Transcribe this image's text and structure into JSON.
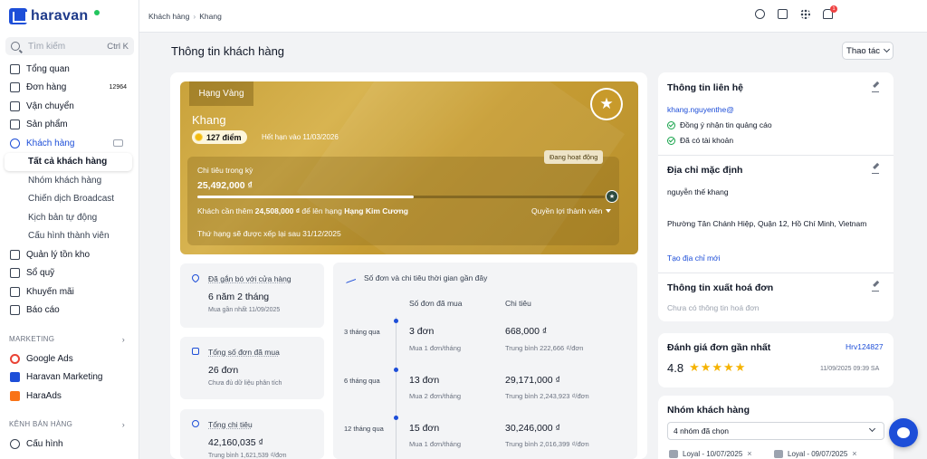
{
  "app": {
    "brand": "haravan"
  },
  "sidebar": {
    "search_placeholder": "Tìm kiếm",
    "search_shortcut": "Ctrl K",
    "items": [
      {
        "label": "Tổng quan",
        "icon": "dashboard-icon"
      },
      {
        "label": "Đơn hàng",
        "icon": "cart-icon",
        "badge": "12964"
      },
      {
        "label": "Vận chuyển",
        "icon": "truck-icon"
      },
      {
        "label": "Sản phẩm",
        "icon": "tag-icon"
      },
      {
        "label": "Khách hàng",
        "icon": "users-icon"
      }
    ],
    "customer_subitems": [
      "Tất cả khách hàng",
      "Nhóm khách hàng",
      "Chiến dịch Broadcast",
      "Kịch bản tự động",
      "Cấu hình thành viên"
    ],
    "items_after": [
      {
        "label": "Quản lý tồn kho",
        "icon": "inventory-icon"
      },
      {
        "label": "Sổ quỹ",
        "icon": "cash-icon"
      },
      {
        "label": "Khuyến mãi",
        "icon": "gift-icon"
      },
      {
        "label": "Báo cáo",
        "icon": "report-icon"
      }
    ],
    "group_marketing": "MARKETING",
    "marketing_items": [
      {
        "label": "Google Ads",
        "color": "#ea4335"
      },
      {
        "label": "Haravan Marketing",
        "color": "#1d4ed8"
      },
      {
        "label": "HaraAds",
        "color": "#f97316"
      }
    ],
    "group_channels": "KÊNH BÁN HÀNG",
    "settings_label": "Cấu hình"
  },
  "topbar": {
    "breadcrumb": [
      "Khách hàng",
      "Khang"
    ],
    "notification_count": "1"
  },
  "main": {
    "title": "Thông tin khách hàng",
    "actions_label": "Thao tác"
  },
  "membership": {
    "rank": "Hạng Vàng",
    "name": "Khang",
    "points": "127 điểm",
    "expiry": "Hết hạn vào 11/03/2026",
    "status": "Đang hoạt động",
    "spend_label": "Chi tiêu trong kỳ",
    "spend_value": "25,492,000 ₫",
    "progress_fraction": 0.53,
    "need_prefix": "Khách cần thêm ",
    "need_amount": "24,508,000 ₫",
    "need_middle": " để lên hạng ",
    "next_rank": "Hạng Kim Cương",
    "benefits_label": "Quyền lợi thành viên",
    "rerank_note": "Thứ hạng sẽ được xếp lại sau 31/12/2025"
  },
  "stats": [
    {
      "label": "Đã gắn bó với cửa hàng",
      "value": "6 năm 2 tháng",
      "sub": "Mua gần nhất 11/09/2025",
      "icon": "heart-icon"
    },
    {
      "label": "Tổng số đơn đã mua",
      "value": "26 đơn",
      "sub": "Chưa đủ dữ liệu phân tích",
      "icon": "bag-icon"
    },
    {
      "label": "Tổng chi tiêu",
      "value": "42,160,035 ₫",
      "sub": "Trung bình 1,621,539 ₫/đơn",
      "icon": "money-icon"
    }
  ],
  "recent": {
    "title": "Số đơn và chi tiêu thời gian gần đây",
    "col_orders": "Số đơn đã mua",
    "col_spend": "Chi tiêu",
    "rows": [
      {
        "period": "3 tháng qua",
        "orders": "3 đơn",
        "orders_sub": "Mua 1 đơn/tháng",
        "spend": "668,000 ₫",
        "spend_sub": "Trung bình 222,666 ₫/đơn"
      },
      {
        "period": "6 tháng qua",
        "orders": "13 đơn",
        "orders_sub": "Mua 2 đơn/tháng",
        "spend": "29,171,000 ₫",
        "spend_sub": "Trung bình 2,243,923 ₫/đơn"
      },
      {
        "period": "12 tháng qua",
        "orders": "15 đơn",
        "orders_sub": "Mua 1 đơn/tháng",
        "spend": "30,246,000 ₫",
        "spend_sub": "Trung bình 2,016,399 ₫/đơn"
      }
    ]
  },
  "contact": {
    "title": "Thông tin liên hệ",
    "email": "khang.nguyenthe@",
    "checks": [
      "Đồng ý nhận tin quảng cáo",
      "Đã có tài khoản"
    ],
    "address_title": "Địa chỉ mặc định",
    "address_name": "nguyễn thế khang",
    "address_line": "Phường Tân Chánh Hiệp, Quận 12, Hồ Chí Minh, Vietnam",
    "add_address": "Tạo địa chỉ mới",
    "invoice_title": "Thông tin xuất hoá đơn",
    "invoice_empty": "Chưa có thông tin hoá đơn"
  },
  "review": {
    "title": "Đánh giá đơn gần nhất",
    "order": "Hrv124827",
    "score": "4.8",
    "stars": "★★★★★",
    "date": "11/09/2025 09:39 SA"
  },
  "groups": {
    "title": "Nhóm khách hàng",
    "selected": "4 nhóm đã chọn",
    "tags": [
      "Loyal - 10/07/2025",
      "Loyal - 09/07/2025"
    ]
  }
}
